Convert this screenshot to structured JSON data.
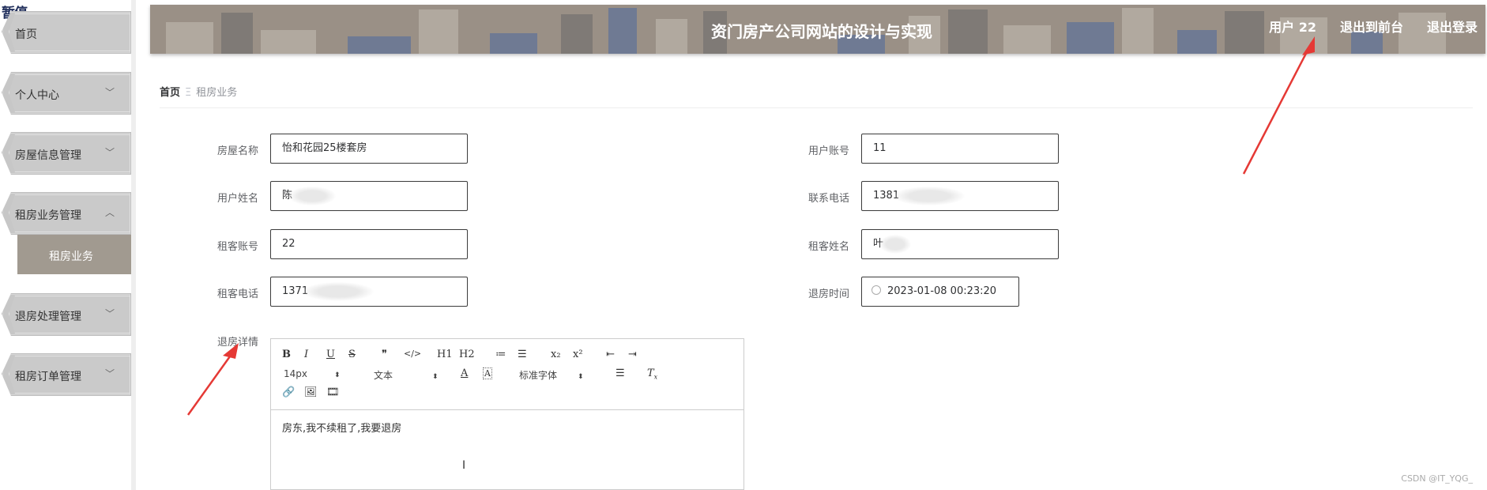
{
  "brand": "暂停",
  "sidebar": {
    "items": [
      {
        "label": "首页",
        "chevron": ""
      },
      {
        "label": "个人中心",
        "chevron": "﹀"
      },
      {
        "label": "房屋信息管理",
        "chevron": "﹀"
      },
      {
        "label": "租房业务管理",
        "chevron": "︿"
      },
      {
        "label": "退房处理管理",
        "chevron": "﹀"
      },
      {
        "label": "租房订单管理",
        "chevron": "﹀"
      }
    ],
    "submenu_active": "租房业务"
  },
  "header": {
    "title": "资门房产公司网站的设计与实现",
    "user": "用户 22",
    "to_front": "退出到前台",
    "logout": "退出登录"
  },
  "breadcrumb": {
    "home": "首页",
    "separator": "Ξ",
    "current": "租房业务"
  },
  "form": {
    "house_name": {
      "label": "房屋名称",
      "value": "怡和花园25楼套房"
    },
    "user_account": {
      "label": "用户账号",
      "value": "11"
    },
    "user_name": {
      "label": "用户姓名",
      "value": "陈"
    },
    "contact_phone": {
      "label": "联系电话",
      "value": "1381"
    },
    "tenant_account": {
      "label": "租客账号",
      "value": "22"
    },
    "tenant_name": {
      "label": "租客姓名",
      "value": "叶"
    },
    "tenant_phone": {
      "label": "租客电话",
      "value": "1371"
    },
    "checkout_time": {
      "label": "退房时间",
      "value": "2023-01-08 00:23:20"
    },
    "checkout_details": {
      "label": "退房详情"
    }
  },
  "editor": {
    "toolbar_row1": [
      "B",
      "I",
      "U",
      "S",
      "❞",
      "</>",
      "H1",
      "H2",
      "≔",
      "☰",
      "x₂",
      "x²",
      "⇤",
      "⇥"
    ],
    "font_size": "14px",
    "text_type": "文本",
    "font_family": "标准字体",
    "content": "房东,我不续租了,我要退房"
  },
  "watermark": "CSDN @IT_YQG_",
  "colors": {
    "header_bg": "#9a9086",
    "submenu_bg": "#a19a90",
    "arrow": "#e53935"
  }
}
